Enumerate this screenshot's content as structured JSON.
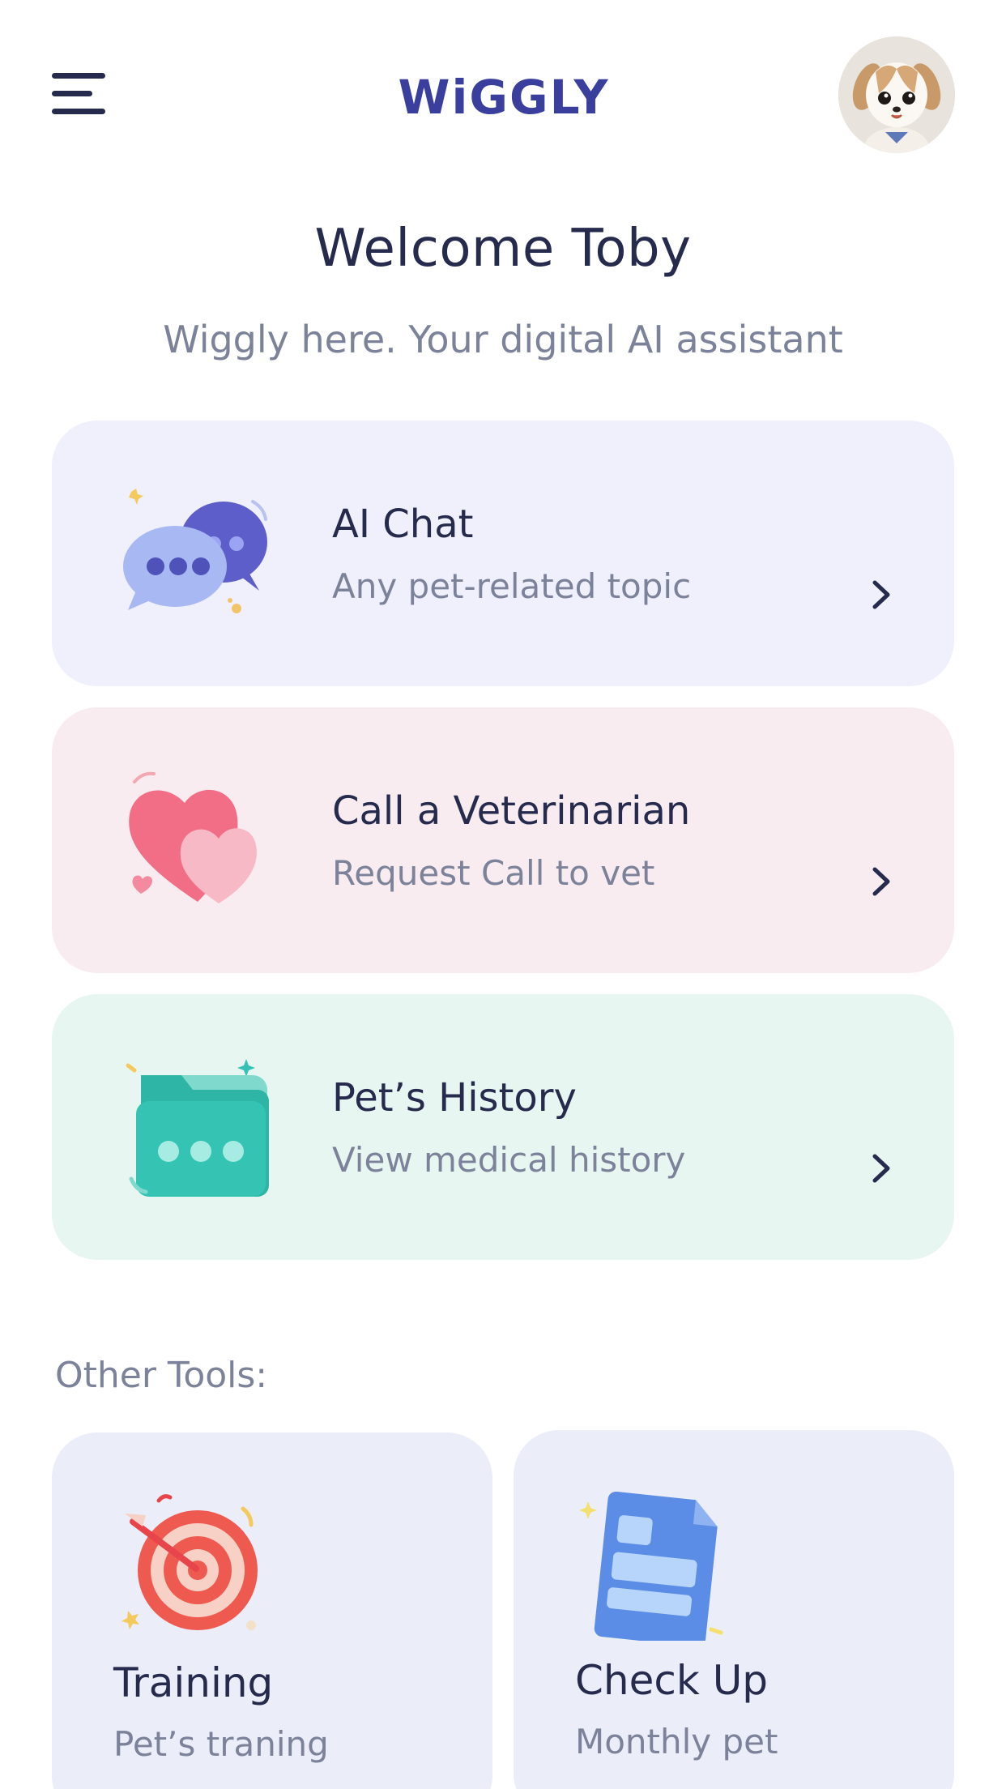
{
  "header": {
    "logo_text": "WiGGLY",
    "menu_icon": "hamburger-menu-icon",
    "avatar_icon": "puppy-avatar"
  },
  "welcome": {
    "title": "Welcome Toby",
    "subtitle": "Wiggly here. Your digital AI assistant"
  },
  "cards": [
    {
      "title": "AI Chat",
      "subtitle": "Any pet-related topic",
      "icon": "chat-bubbles-icon",
      "color": "#f0f0fc"
    },
    {
      "title": "Call a Veterinarian",
      "subtitle": "Request Call to vet",
      "icon": "hearts-icon",
      "color": "#f8ecf1"
    },
    {
      "title": "Pet’s History",
      "subtitle": "View medical history",
      "icon": "folder-icon",
      "color": "#e8f6f2"
    }
  ],
  "other_tools": {
    "label": "Other Tools:",
    "items": [
      {
        "title": "Training",
        "subtitle": "Pet’s traning",
        "icon": "target-icon"
      },
      {
        "title": "Check Up",
        "subtitle": "Monthly pet",
        "icon": "document-icon"
      }
    ]
  },
  "colors": {
    "primary_text": "#262b4d",
    "secondary_text": "#7c8299",
    "logo": "#3a3f9e",
    "tool_card": "#ebeef8"
  }
}
